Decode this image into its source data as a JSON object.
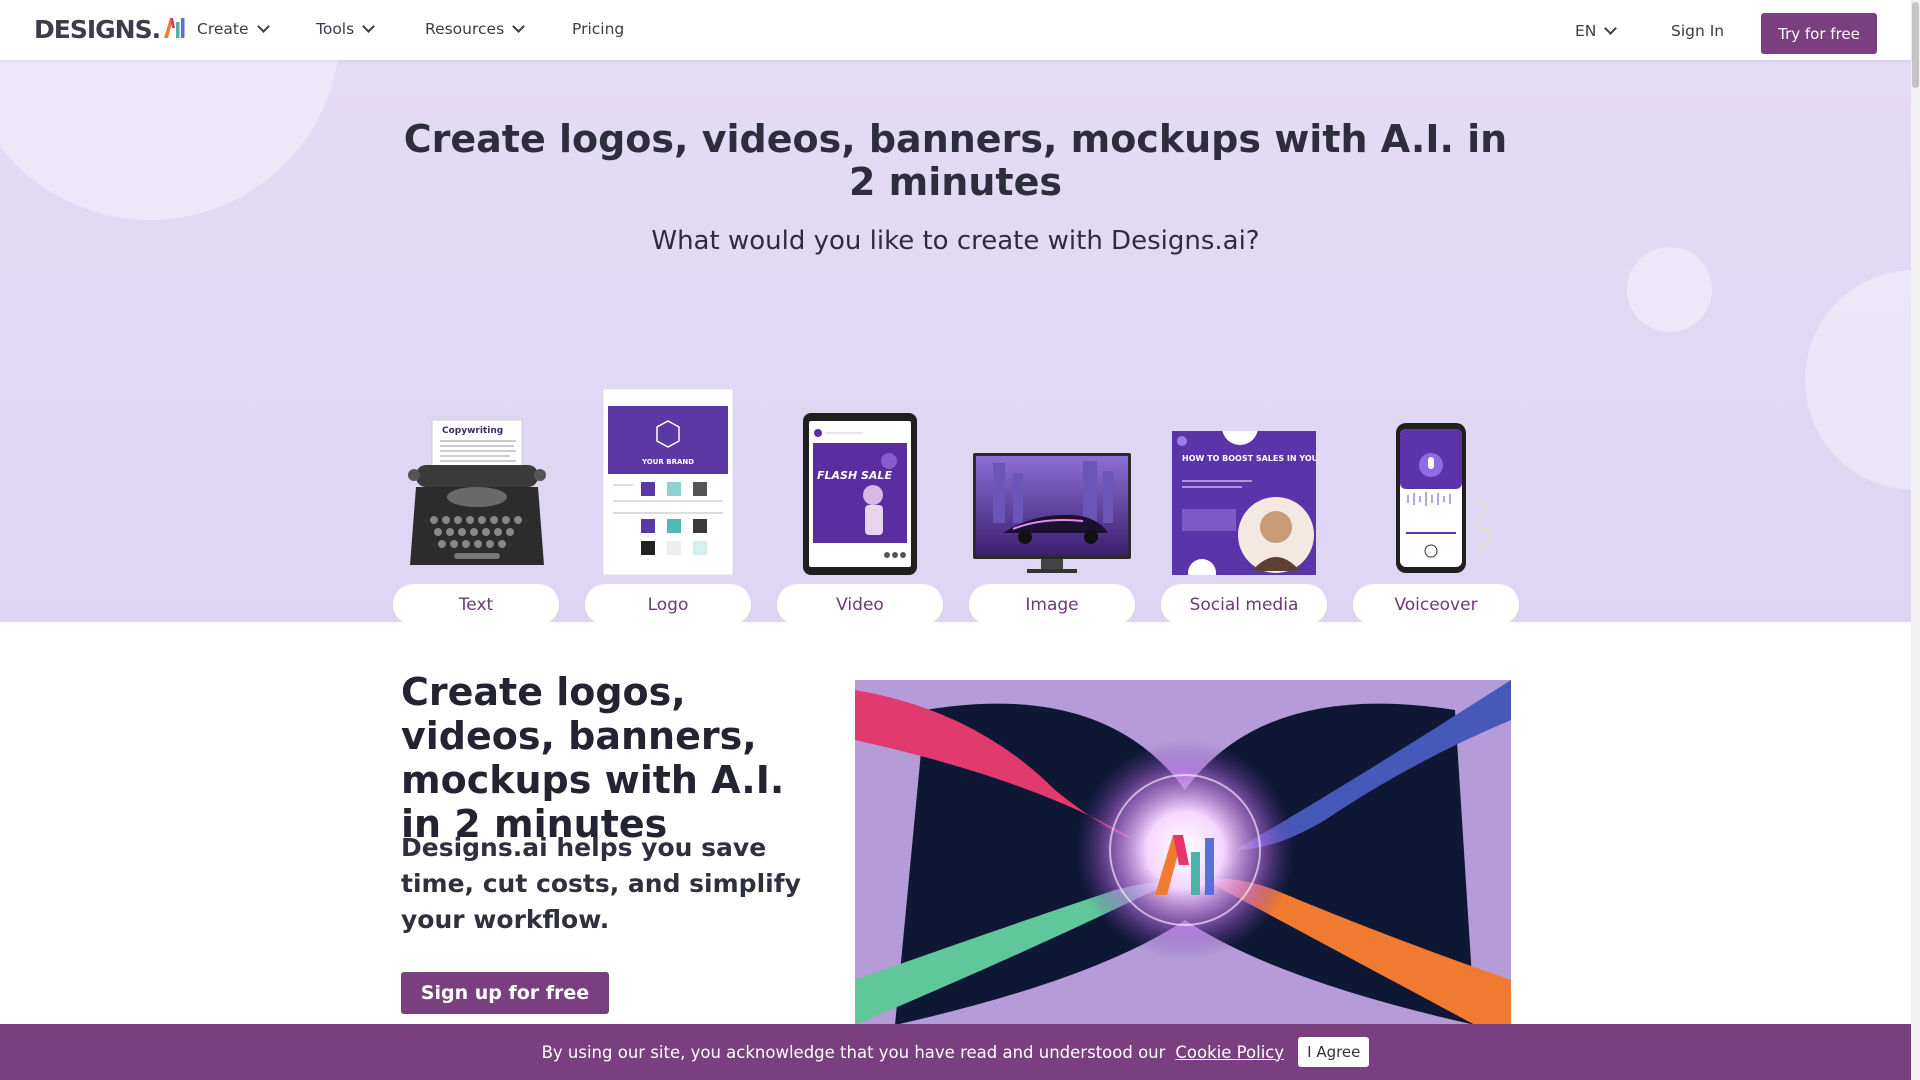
{
  "header": {
    "logo_text": "DESIGNS.",
    "logo_ai": "AI",
    "nav": [
      {
        "label": "Create",
        "dropdown": true
      },
      {
        "label": "Tools",
        "dropdown": true
      },
      {
        "label": "Resources",
        "dropdown": true
      },
      {
        "label": "Pricing",
        "dropdown": false
      }
    ],
    "language": "EN",
    "sign_in": "Sign In",
    "try_free": "Try for free"
  },
  "hero": {
    "title": "Create logos, videos, banners, mockups with A.I. in 2 minutes",
    "subtitle": "What would you like to create with Designs.ai?",
    "cards": [
      {
        "label": "Text",
        "icon": "typewriter-icon"
      },
      {
        "label": "Logo",
        "icon": "brand-sheet-icon"
      },
      {
        "label": "Video",
        "icon": "tablet-video-icon"
      },
      {
        "label": "Image",
        "icon": "monitor-image-icon"
      },
      {
        "label": "Social media",
        "icon": "social-post-icon"
      },
      {
        "label": "Voiceover",
        "icon": "phone-audio-icon"
      }
    ],
    "card_texts": {
      "copywriting": "Copywriting",
      "your_brand": "YOUR BRAND",
      "flash_sale": "FLASH SALE",
      "boost_sales": "HOW TO BOOST SALES IN YOUR SMALL BUSINESS"
    }
  },
  "section2": {
    "title": "Create logos, videos, banners, mockups with A.I. in 2 minutes",
    "body": "Designs.ai helps you save time, cut costs, and simplify your workflow.",
    "signup": "Sign up for free"
  },
  "cookie": {
    "text": "By using our site, you acknowledge that you have read and understood our",
    "link": "Cookie Policy",
    "agree": "I Agree"
  },
  "colors": {
    "brand": "#7a3f7e",
    "hero_bg": "#e0d8f5",
    "text": "#2d2d3d"
  }
}
